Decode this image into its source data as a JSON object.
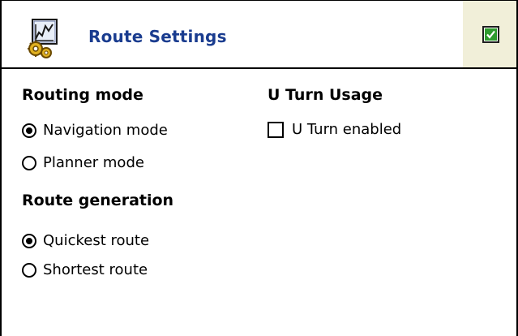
{
  "header": {
    "title": "Route Settings",
    "icon": "route-settings-gear-icon",
    "ok_icon": "checkbox-ok-icon"
  },
  "routing_mode": {
    "heading": "Routing mode",
    "options": [
      {
        "label": "Navigation mode",
        "selected": true
      },
      {
        "label": "Planner mode",
        "selected": false
      }
    ]
  },
  "route_generation": {
    "heading": "Route generation",
    "options": [
      {
        "label": "Quickest route",
        "selected": true
      },
      {
        "label": "Shortest route",
        "selected": false
      }
    ]
  },
  "u_turn": {
    "heading": "U Turn Usage",
    "checkbox_label": "U Turn enabled",
    "checked": false
  },
  "colors": {
    "title": "#1a3c8f",
    "ok_area_bg": "#f1efd9",
    "ok_check": "#2e9b2e"
  }
}
